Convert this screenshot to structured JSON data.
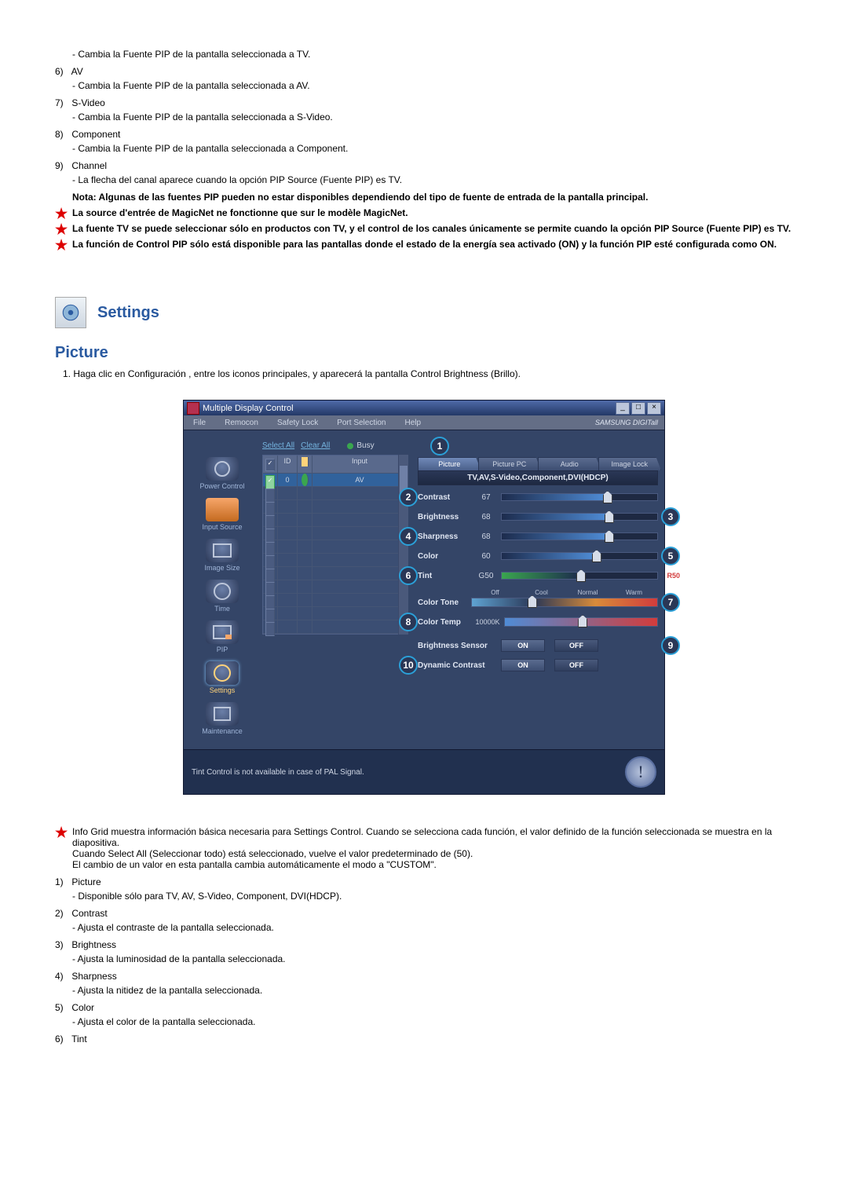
{
  "topItems": [
    {
      "desc": "- Cambia la Fuente PIP de la pantalla seleccionada a TV."
    },
    {
      "num": "6)",
      "title": "AV",
      "desc": "- Cambia la Fuente PIP de la pantalla seleccionada a AV."
    },
    {
      "num": "7)",
      "title": "S-Video",
      "desc": "- Cambia la Fuente PIP de la pantalla seleccionada a S-Video."
    },
    {
      "num": "8)",
      "title": "Component",
      "desc": "- Cambia la Fuente PIP de la pantalla seleccionada a Component."
    },
    {
      "num": "9)",
      "title": "Channel",
      "desc": "- La flecha del canal aparece cuando la opción PIP Source (Fuente PIP) es TV."
    }
  ],
  "note": "Nota: Algunas de las fuentes PIP pueden no estar disponibles dependiendo del tipo de fuente de entrada de la pantalla principal.",
  "stars": [
    "La source d'entrée de MagicNet ne fonctionne que sur le modèle MagicNet.",
    "La fuente TV se puede seleccionar sólo en productos con TV, y el control de los canales únicamente se permite cuando la opción PIP Source (Fuente PIP) es TV.",
    "La función de Control PIP sólo está disponible para las pantallas donde el estado de la energía sea activado (ON) y la función PIP esté configurada como ON."
  ],
  "sectionTitle": "Settings",
  "subTitle": "Picture",
  "introNum": "1.",
  "intro": "Haga clic en Configuración , entre los iconos principales, y aparecerá la pantalla Control Brightness (Brillo).",
  "mdc": {
    "title": "Multiple Display Control",
    "menus": [
      "File",
      "Remocon",
      "Safety Lock",
      "Port Selection",
      "Help"
    ],
    "brand": "SAMSUNG DIGITall",
    "selectAll": "Select All",
    "clearAll": "Clear All",
    "busy": "Busy",
    "gridHead": {
      "id": "ID",
      "input": "Input"
    },
    "row0": {
      "id": "0",
      "input": "AV"
    },
    "sidebar": [
      {
        "label": "Power Control"
      },
      {
        "label": "Input Source"
      },
      {
        "label": "Image Size"
      },
      {
        "label": "Time"
      },
      {
        "label": "PIP"
      },
      {
        "label": "Settings"
      },
      {
        "label": "Maintenance"
      }
    ],
    "tabs": [
      "Picture",
      "Picture PC",
      "Audio",
      "Image Lock"
    ],
    "modeStrip": "TV,AV,S-Video,Component,DVI(HDCP)",
    "controls": {
      "contrast": {
        "label": "Contrast",
        "val": "67"
      },
      "brightness": {
        "label": "Brightness",
        "val": "68"
      },
      "sharpness": {
        "label": "Sharpness",
        "val": "68"
      },
      "color": {
        "label": "Color",
        "val": "60"
      },
      "tint": {
        "label": "Tint",
        "val": "G50",
        "r": "R50"
      },
      "colortone": {
        "label": "Color Tone",
        "opts": [
          "Off",
          "Cool",
          "Normal",
          "Warm"
        ]
      },
      "colortemp": {
        "label": "Color Temp",
        "val": "10000K"
      },
      "bsensor": {
        "label": "Brightness Sensor",
        "on": "ON",
        "off": "OFF"
      },
      "dcontrast": {
        "label": "Dynamic Contrast",
        "on": "ON",
        "off": "OFF"
      }
    },
    "status": "Tint Control is not available in case of PAL Signal."
  },
  "infoStar": [
    "Info Grid muestra información básica necesaria para Settings Control. Cuando se selecciona cada función, el valor definido de la función seleccionada se muestra en la diapositiva.",
    "Cuando Select All (Seleccionar todo) está seleccionado, vuelve el valor predeterminado de (50).",
    "El cambio de un valor en esta pantalla cambia automáticamente el modo a \"CUSTOM\"."
  ],
  "bottomItems": [
    {
      "num": "1)",
      "title": "Picture",
      "desc": "- Disponible sólo para TV, AV, S-Video, Component, DVI(HDCP)."
    },
    {
      "num": "2)",
      "title": "Contrast",
      "desc": "- Ajusta el contraste de la pantalla seleccionada."
    },
    {
      "num": "3)",
      "title": "Brightness",
      "desc": "- Ajusta la luminosidad de la pantalla seleccionada."
    },
    {
      "num": "4)",
      "title": "Sharpness",
      "desc": "- Ajusta la nitidez de la pantalla seleccionada."
    },
    {
      "num": "5)",
      "title": "Color",
      "desc": "- Ajusta el color de la pantalla seleccionada."
    },
    {
      "num": "6)",
      "title": "Tint"
    }
  ]
}
